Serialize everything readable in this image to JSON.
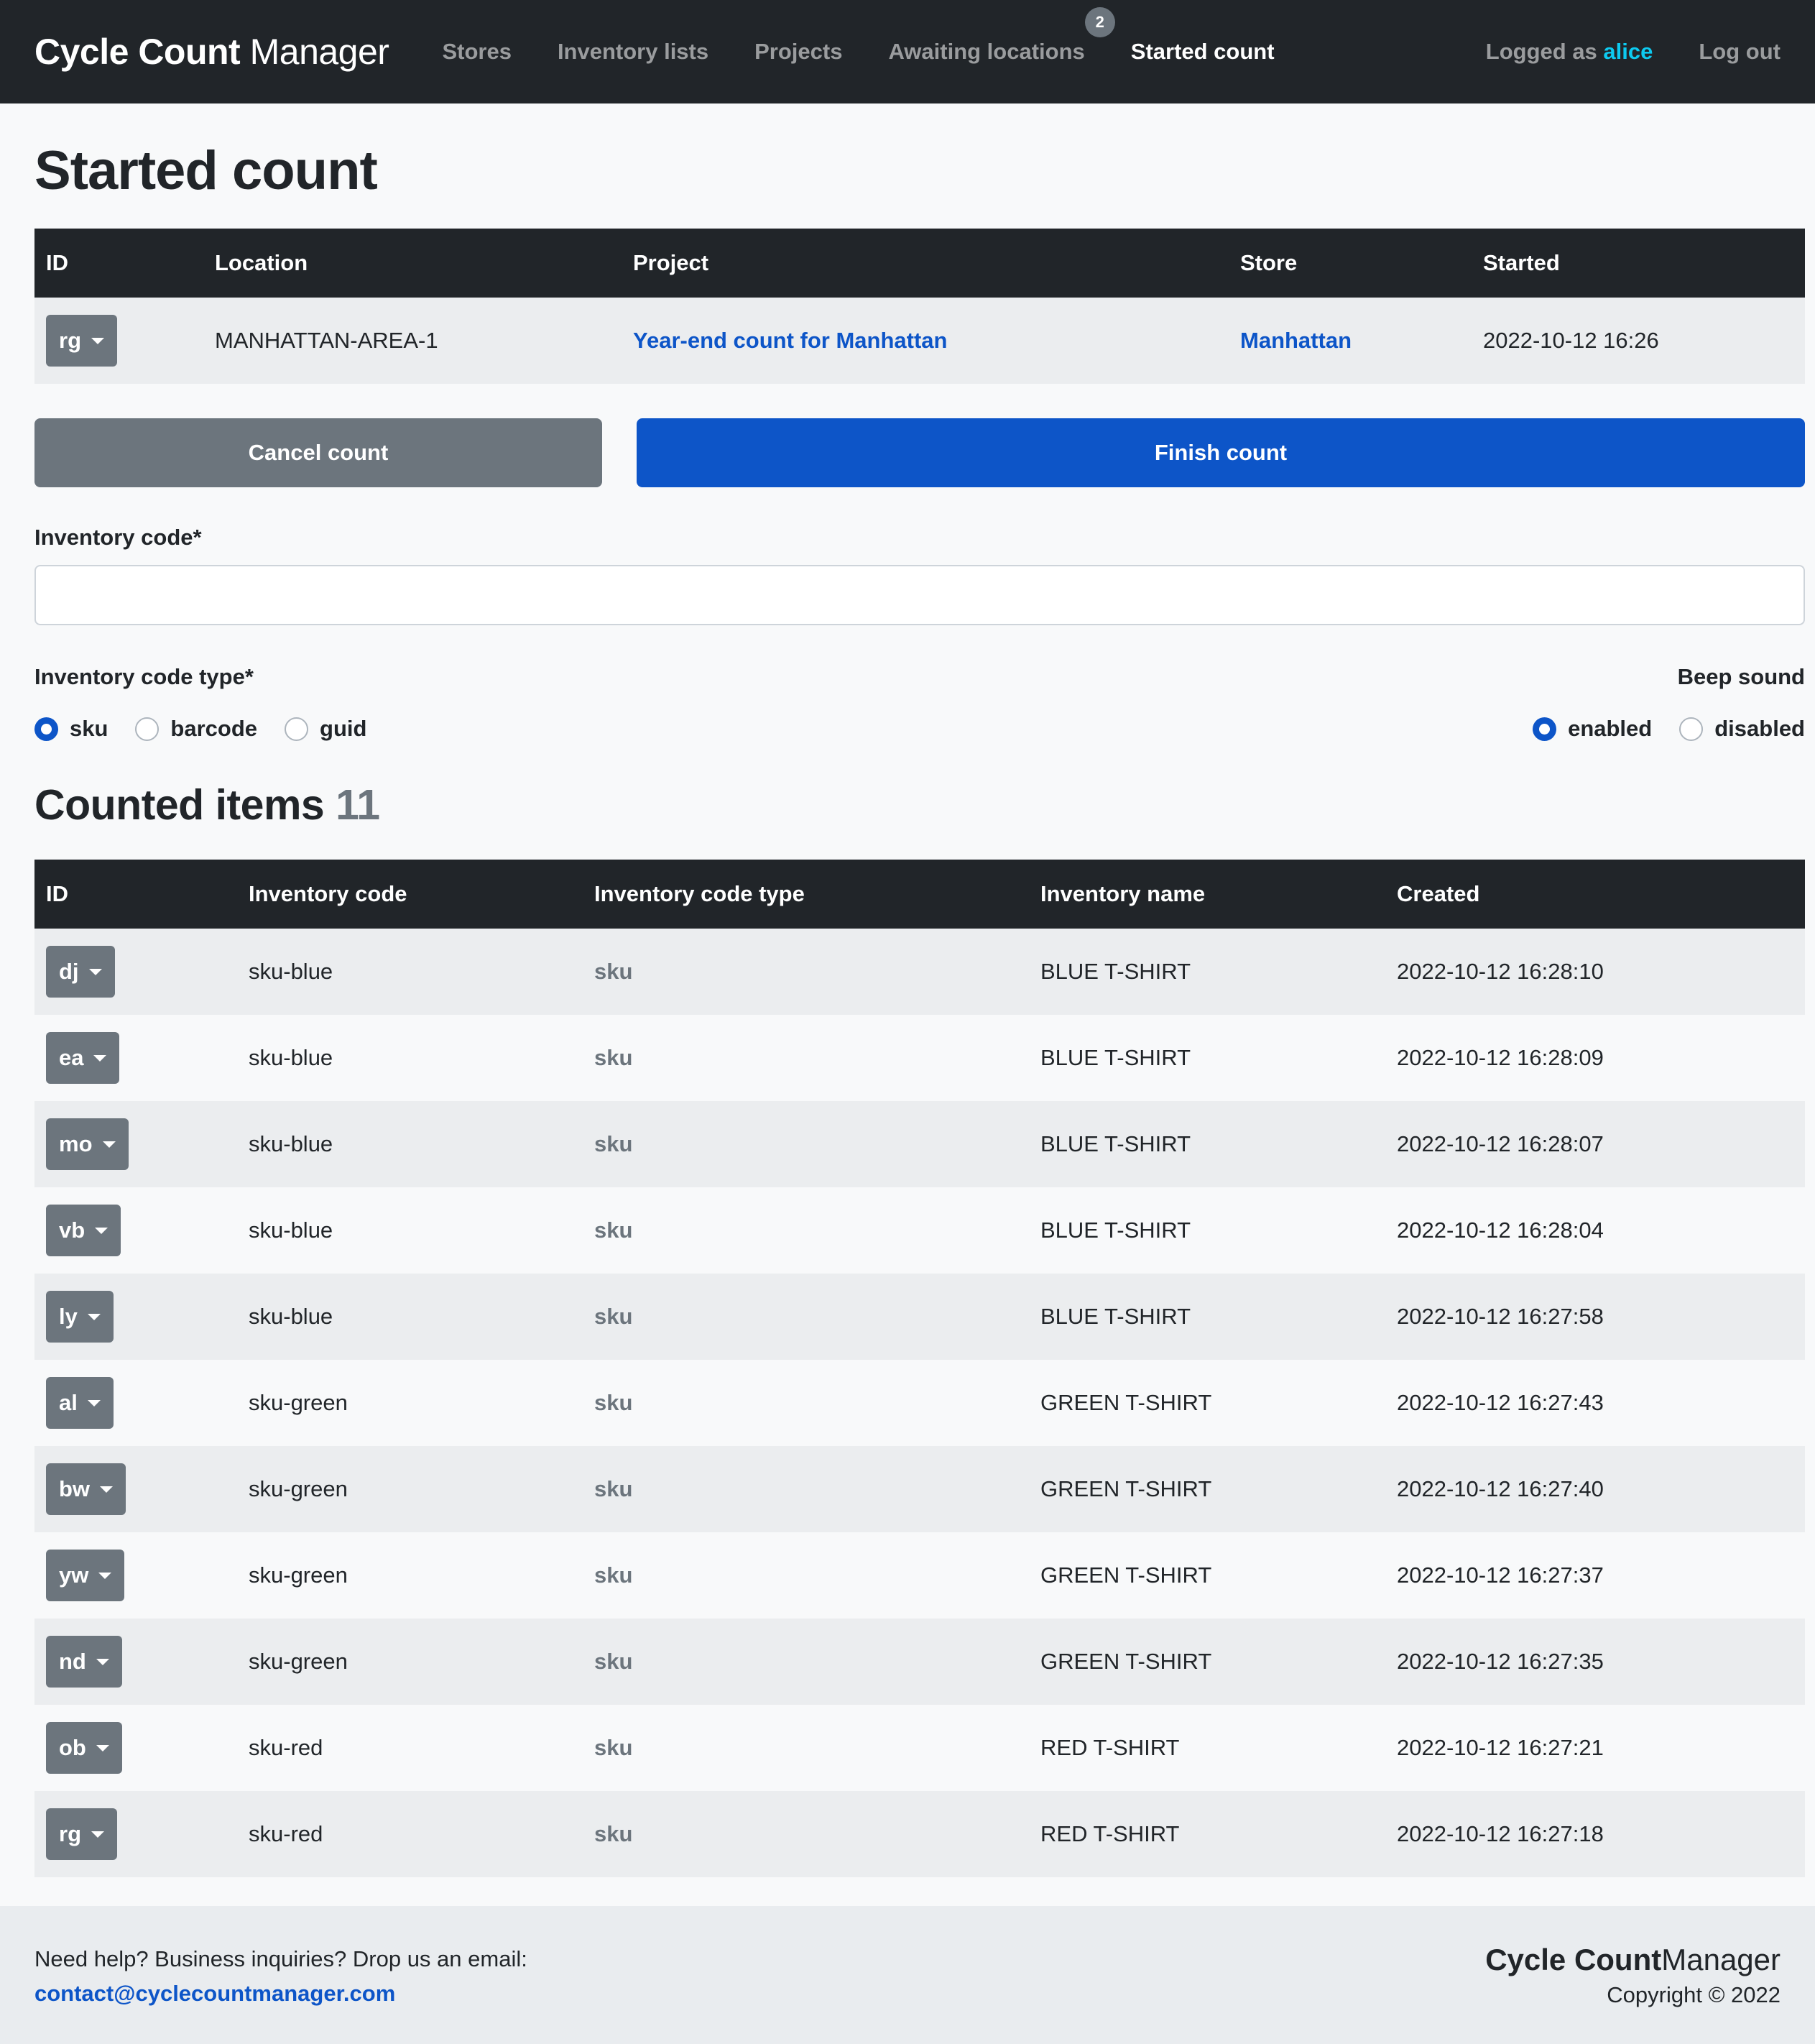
{
  "brand": {
    "bold": "Cycle Count",
    "light": "Manager"
  },
  "nav": {
    "links": [
      {
        "label": "Stores"
      },
      {
        "label": "Inventory lists"
      },
      {
        "label": "Projects"
      },
      {
        "label": "Awaiting locations",
        "badge": "2"
      },
      {
        "label": "Started count"
      }
    ],
    "logged_as": "Logged as",
    "user": "alice",
    "logout": "Log out"
  },
  "page_title": "Started count",
  "count_table": {
    "headers": [
      "ID",
      "Location",
      "Project",
      "Store",
      "Started"
    ],
    "row": {
      "id": "rg",
      "location": "MANHATTAN-AREA-1",
      "project": "Year-end count for Manhattan",
      "store": "Manhattan",
      "started": "2022-10-12 16:26"
    }
  },
  "buttons": {
    "cancel": "Cancel count",
    "finish": "Finish count"
  },
  "inventory_code": {
    "label": "Inventory code*",
    "value": ""
  },
  "code_type": {
    "label": "Inventory code type*",
    "options": [
      "sku",
      "barcode",
      "guid"
    ],
    "selected": "sku"
  },
  "beep": {
    "label": "Beep sound",
    "options": [
      "enabled",
      "disabled"
    ],
    "selected": "enabled"
  },
  "counted": {
    "title": "Counted items",
    "count": "11",
    "headers": [
      "ID",
      "Inventory code",
      "Inventory code type",
      "Inventory name",
      "Created"
    ],
    "rows": [
      {
        "id": "dj",
        "code": "sku-blue",
        "type": "sku",
        "name": "BLUE T-SHIRT",
        "created": "2022-10-12 16:28:10"
      },
      {
        "id": "ea",
        "code": "sku-blue",
        "type": "sku",
        "name": "BLUE T-SHIRT",
        "created": "2022-10-12 16:28:09"
      },
      {
        "id": "mo",
        "code": "sku-blue",
        "type": "sku",
        "name": "BLUE T-SHIRT",
        "created": "2022-10-12 16:28:07"
      },
      {
        "id": "vb",
        "code": "sku-blue",
        "type": "sku",
        "name": "BLUE T-SHIRT",
        "created": "2022-10-12 16:28:04"
      },
      {
        "id": "ly",
        "code": "sku-blue",
        "type": "sku",
        "name": "BLUE T-SHIRT",
        "created": "2022-10-12 16:27:58"
      },
      {
        "id": "al",
        "code": "sku-green",
        "type": "sku",
        "name": "GREEN T-SHIRT",
        "created": "2022-10-12 16:27:43"
      },
      {
        "id": "bw",
        "code": "sku-green",
        "type": "sku",
        "name": "GREEN T-SHIRT",
        "created": "2022-10-12 16:27:40"
      },
      {
        "id": "yw",
        "code": "sku-green",
        "type": "sku",
        "name": "GREEN T-SHIRT",
        "created": "2022-10-12 16:27:37"
      },
      {
        "id": "nd",
        "code": "sku-green",
        "type": "sku",
        "name": "GREEN T-SHIRT",
        "created": "2022-10-12 16:27:35"
      },
      {
        "id": "ob",
        "code": "sku-red",
        "type": "sku",
        "name": "RED T-SHIRT",
        "created": "2022-10-12 16:27:21"
      },
      {
        "id": "rg",
        "code": "sku-red",
        "type": "sku",
        "name": "RED T-SHIRT",
        "created": "2022-10-12 16:27:18"
      }
    ]
  },
  "footer": {
    "help_text": "Need help? Business inquiries? Drop us an email:",
    "email": "contact@cyclecountmanager.com",
    "copyright": "Copyright © 2022"
  },
  "colors": {
    "navbar": "#212529",
    "primary": "#0d55c8",
    "secondary": "#6c757d",
    "user_accent": "#0dcaf0"
  },
  "icons": {
    "id_dropdown": "caret-down-icon",
    "radio": "radio-icon"
  }
}
